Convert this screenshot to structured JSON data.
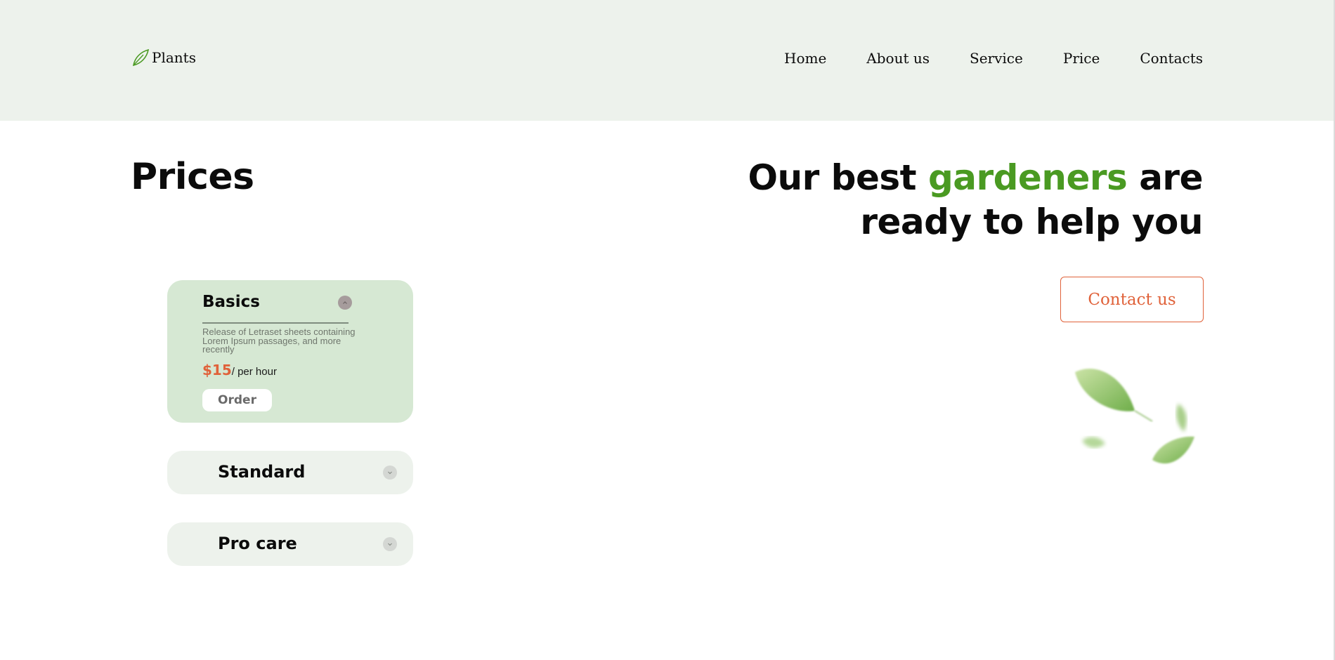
{
  "header": {
    "logo": {
      "icon": "leaf-icon",
      "text": "Plants"
    },
    "nav": [
      {
        "label": "Home"
      },
      {
        "label": "About us"
      },
      {
        "label": "Service"
      },
      {
        "label": "Price"
      },
      {
        "label": "Contacts"
      }
    ]
  },
  "main": {
    "title": "Prices",
    "headline": {
      "part1": "Our best ",
      "accent": "gardeners",
      "part2": " are ready to help you"
    },
    "contact_button": "Contact us",
    "decoration_icon": "falling-leaves-icon"
  },
  "pricing": {
    "basics": {
      "title": "Basics",
      "description": "Release of Letraset sheets containing Lorem Ipsum passages, and more recently",
      "price": "$15",
      "unit": "/ per hour",
      "order_label": "Order",
      "toggle_icon": "chevron-up-icon",
      "expanded": true
    },
    "standard": {
      "title": "Standard",
      "toggle_icon": "chevron-down-icon",
      "expanded": false
    },
    "procare": {
      "title": "Pro care",
      "toggle_icon": "chevron-down-icon",
      "expanded": false
    }
  },
  "colors": {
    "header_bg": "#edf2ec",
    "accent_green": "#4a9a22",
    "accent_orange": "#e0623a",
    "card_open_bg": "#d6e8d3",
    "card_closed_bg": "#edf2ec"
  }
}
